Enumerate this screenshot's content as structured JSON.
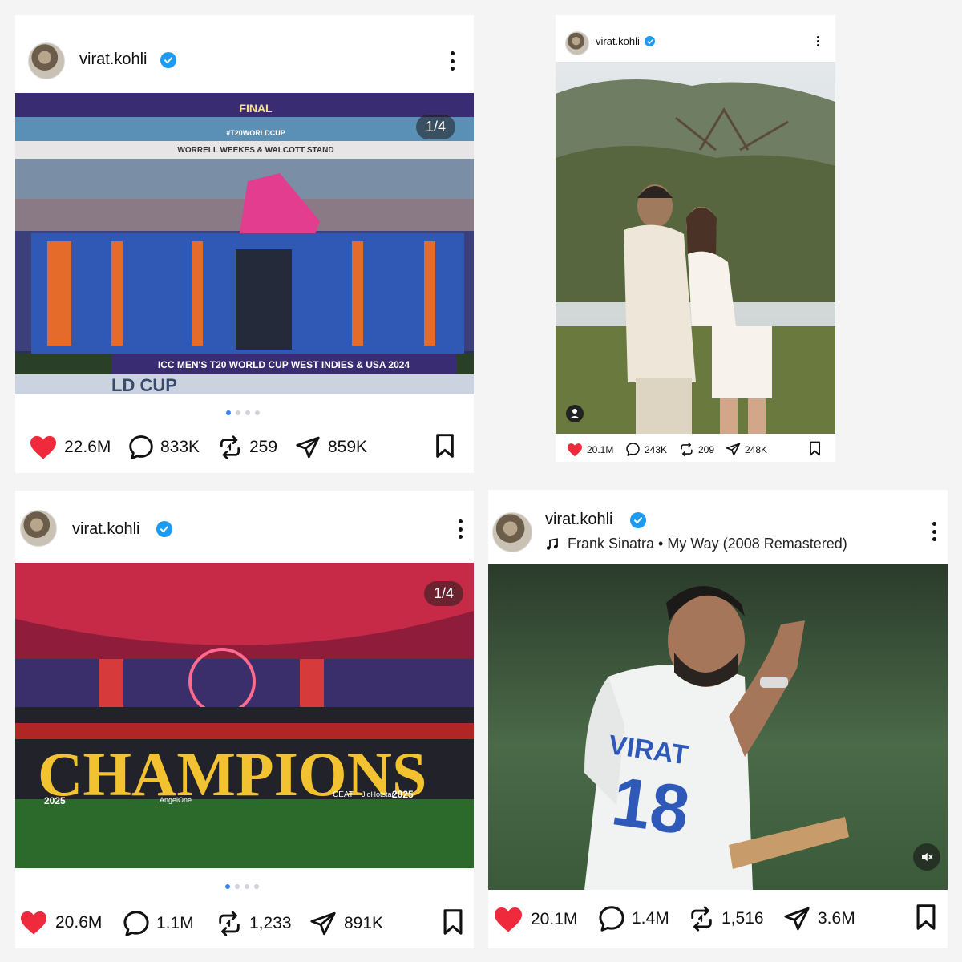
{
  "posts": [
    {
      "username": "virat.kohli",
      "media_counter": "1/4",
      "carousel_pages": 4,
      "carousel_current": 1,
      "image_text": {
        "banner_top": "FINAL",
        "hashtag": "#T20WORLDCUP",
        "stand": "WORRELL WEEKES & WALCOTT STAND",
        "bottom_banner": "ICC MEN'S T20 WORLD CUP WEST INDIES & USA 2024",
        "ground": "LD CUP"
      },
      "likes": "22.6M",
      "comments": "833K",
      "reposts": "259",
      "shares": "859K"
    },
    {
      "username": "virat.kohli",
      "likes": "20.1M",
      "comments": "243K",
      "reposts": "209",
      "shares": "248K"
    },
    {
      "username": "virat.kohli",
      "media_counter": "1/4",
      "carousel_pages": 4,
      "carousel_current": 1,
      "image_text": {
        "headline": "CHAMPIONS",
        "year_left": "2025",
        "year_right": "2025",
        "sponsor_1": "AngelOne",
        "sponsor_2": "CEAT",
        "sponsor_3": "JioHotstar"
      },
      "likes": "20.6M",
      "comments": "1.1M",
      "reposts": "1,233",
      "shares": "891K"
    },
    {
      "username": "virat.kohli",
      "audio": "Frank Sinatra • My Way (2008 Remastered)",
      "image_text": {
        "jersey_name": "VIRAT",
        "jersey_number": "18"
      },
      "likes": "20.1M",
      "comments": "1.4M",
      "reposts": "1,516",
      "shares": "3.6M"
    }
  ],
  "icons": {
    "like": "heart-icon",
    "comment": "comment-icon",
    "repost": "repost-icon",
    "share": "share-icon",
    "save": "bookmark-icon",
    "more": "more-vertical-icon",
    "verified": "verified-badge-icon",
    "music": "music-note-icon",
    "mute": "mute-icon",
    "tag": "tagged-user-icon"
  },
  "colors": {
    "heart": "#ef2a3d",
    "verified": "#1d9bf0",
    "carousel_active": "#3b82f6"
  }
}
